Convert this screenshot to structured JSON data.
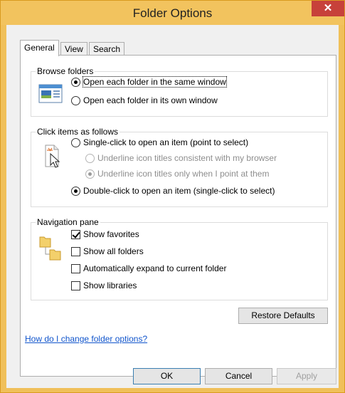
{
  "window": {
    "title": "Folder Options",
    "close_glyph": "✕"
  },
  "tabs": [
    {
      "label": "General",
      "active": true
    },
    {
      "label": "View",
      "active": false
    },
    {
      "label": "Search",
      "active": false
    }
  ],
  "browse_folders": {
    "legend": "Browse folders",
    "icon": "browse-window-icon",
    "options": [
      {
        "label": "Open each folder in the same window",
        "checked": true
      },
      {
        "label": "Open each folder in its own window",
        "checked": false
      }
    ]
  },
  "click_items": {
    "legend": "Click items as follows",
    "icon": "pointer-click-icon",
    "options": [
      {
        "label": "Single-click to open an item (point to select)",
        "checked": false
      },
      {
        "label": "Underline icon titles consistent with my browser",
        "checked": false,
        "disabled": true
      },
      {
        "label": "Underline icon titles only when I point at them",
        "checked": true,
        "disabled": true
      },
      {
        "label": "Double-click to open an item (single-click to select)",
        "checked": true
      }
    ]
  },
  "navigation_pane": {
    "legend": "Navigation pane",
    "icon": "folder-tree-icon",
    "options": [
      {
        "label": "Show favorites",
        "checked": true
      },
      {
        "label": "Show all folders",
        "checked": false
      },
      {
        "label": "Automatically expand to current folder",
        "checked": false
      },
      {
        "label": "Show libraries",
        "checked": false
      }
    ]
  },
  "restore_defaults": "Restore Defaults",
  "help_link": "How do I change folder options?",
  "footer": {
    "ok": "OK",
    "cancel": "Cancel",
    "apply": "Apply"
  },
  "colors": {
    "title_bar": "#f2c35e",
    "close": "#c7413a",
    "link": "#1155cc"
  }
}
